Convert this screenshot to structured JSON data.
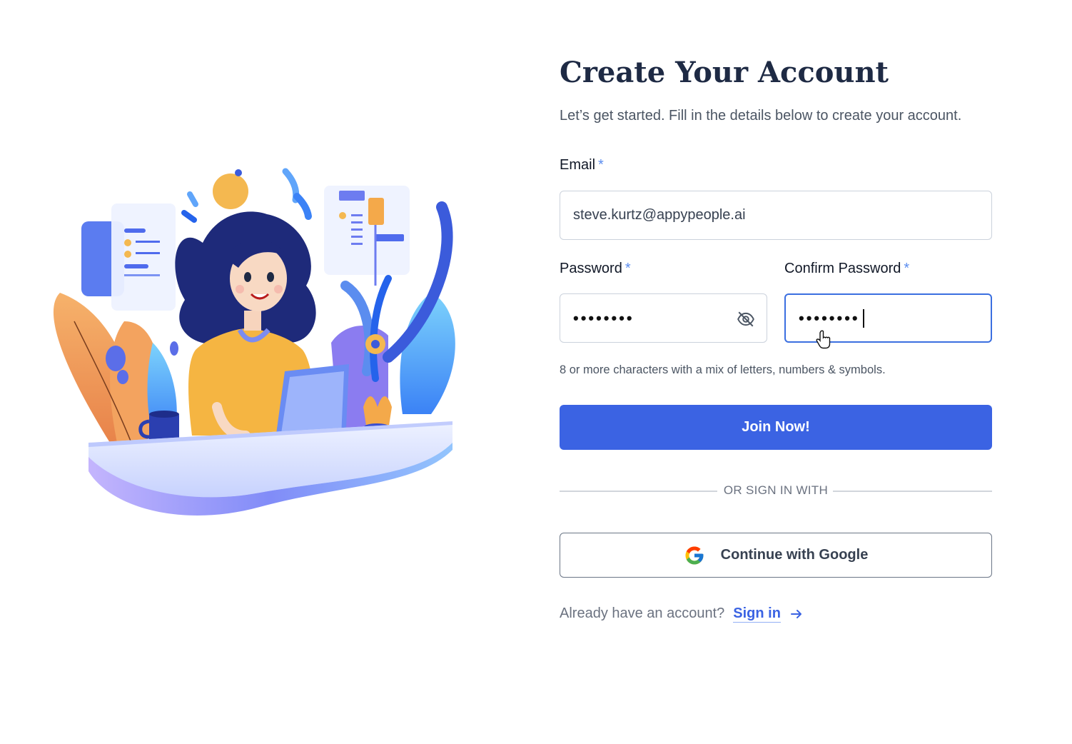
{
  "form": {
    "title": "Create Your Account",
    "subtitle": "Let’s get started. Fill in the details below to create your account.",
    "required_marker": "*",
    "email": {
      "label": "Email",
      "value": "steve.kurtz@appypeople.ai"
    },
    "password": {
      "label": "Password",
      "masked_value": "••••••••",
      "toggle_icon": "eye-off-icon"
    },
    "confirm_password": {
      "label": "Confirm Password",
      "masked_value": "••••••••",
      "focused": true
    },
    "hint": "8 or more characters with a mix of letters, numbers & symbols.",
    "submit_label": "Join Now!",
    "divider_text": "OR SIGN IN WITH",
    "google_label": "Continue with Google",
    "signin_prompt": "Already have an account?",
    "signin_link": "Sign in"
  },
  "colors": {
    "primary": "#3b63e3",
    "title": "#1e2a44",
    "required": "#5b8def",
    "focus_border": "#3b6fe0"
  },
  "illustration": {
    "subject": "woman-working-at-laptop-illustration"
  }
}
